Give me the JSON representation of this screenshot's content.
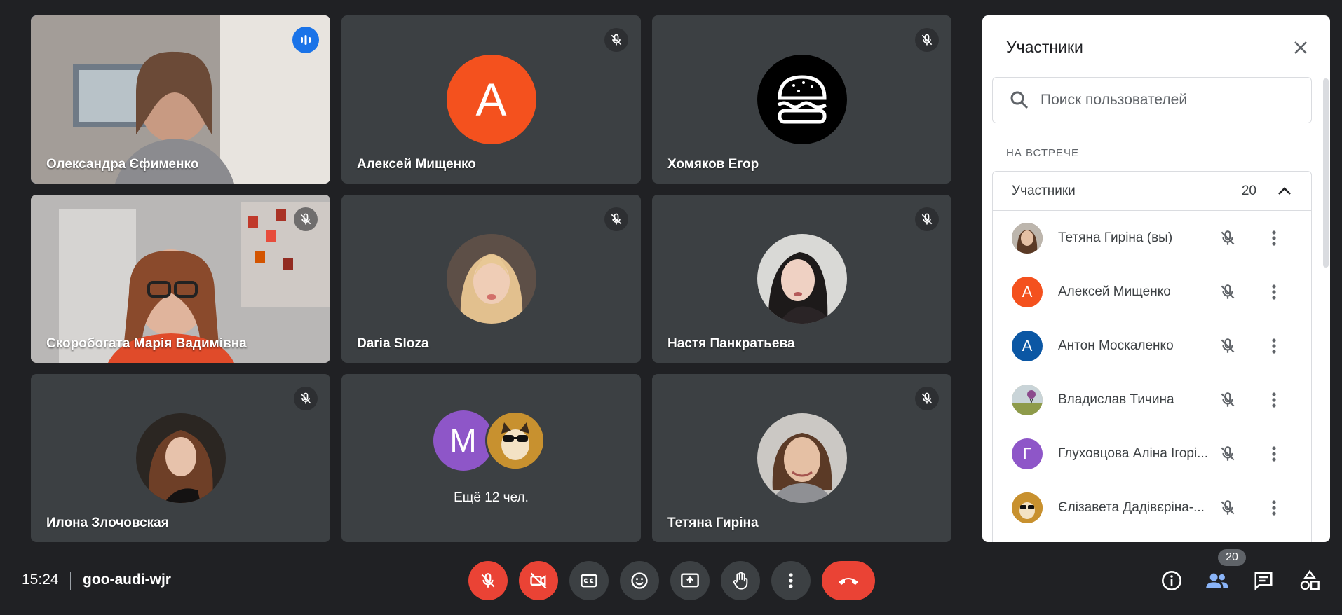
{
  "tiles": [
    {
      "name": "Олександра Єфименко",
      "status": "speaking",
      "type": "video"
    },
    {
      "name": "Алексей Мищенко",
      "status": "muted",
      "type": "avatar-letter",
      "letter": "А",
      "color": "#f4511e"
    },
    {
      "name": "Хомяков Егор",
      "status": "muted",
      "type": "avatar-image",
      "icon": "burger-avatar"
    },
    {
      "name": "Скоробогата Марія Вадимівна",
      "status": "muted",
      "type": "video"
    },
    {
      "name": "Daria Sloza",
      "status": "muted",
      "type": "avatar-image",
      "icon": "photo-avatar"
    },
    {
      "name": "Настя Панкратьева",
      "status": "muted",
      "type": "avatar-image",
      "icon": "photo-avatar"
    },
    {
      "name": "Илона Злочовская",
      "status": "muted",
      "type": "avatar-image",
      "icon": "photo-avatar"
    },
    {
      "name": "",
      "type": "more",
      "letter": "М",
      "more_label": "Ещё 12 чел."
    },
    {
      "name": "Тетяна Гиріна",
      "status": "muted",
      "type": "avatar-image",
      "icon": "photo-avatar"
    }
  ],
  "panel": {
    "title": "Участники",
    "search_placeholder": "Поиск пользователей",
    "section_label": "НА ВСТРЕЧЕ",
    "group_label": "Участники",
    "group_count": "20",
    "people": [
      {
        "name": "Тетяна Гиріна (вы)",
        "avatar": "photo",
        "color": "#8d7b6e"
      },
      {
        "name": "Алексей Мищенко",
        "avatar": "letter",
        "letter": "А",
        "color": "#f4511e"
      },
      {
        "name": "Антон Москаленко",
        "avatar": "letter",
        "letter": "А",
        "color": "#0b57a4"
      },
      {
        "name": "Владислав Тичина",
        "avatar": "photo",
        "color": "#b7a76a"
      },
      {
        "name": "Глуховцова Аліна Ігорі...",
        "avatar": "letter",
        "letter": "Г",
        "color": "#8e56c8"
      },
      {
        "name": "Єлізавета Дадівєріна-...",
        "avatar": "photo",
        "color": "#c8912f"
      }
    ]
  },
  "bottom": {
    "time": "15:24",
    "meeting_code": "goo-audi-wjr",
    "participants_badge": "20"
  },
  "colors": {
    "background": "#202124",
    "tile": "#3c4043",
    "danger": "#ea4335",
    "accent": "#8ab4f8"
  }
}
